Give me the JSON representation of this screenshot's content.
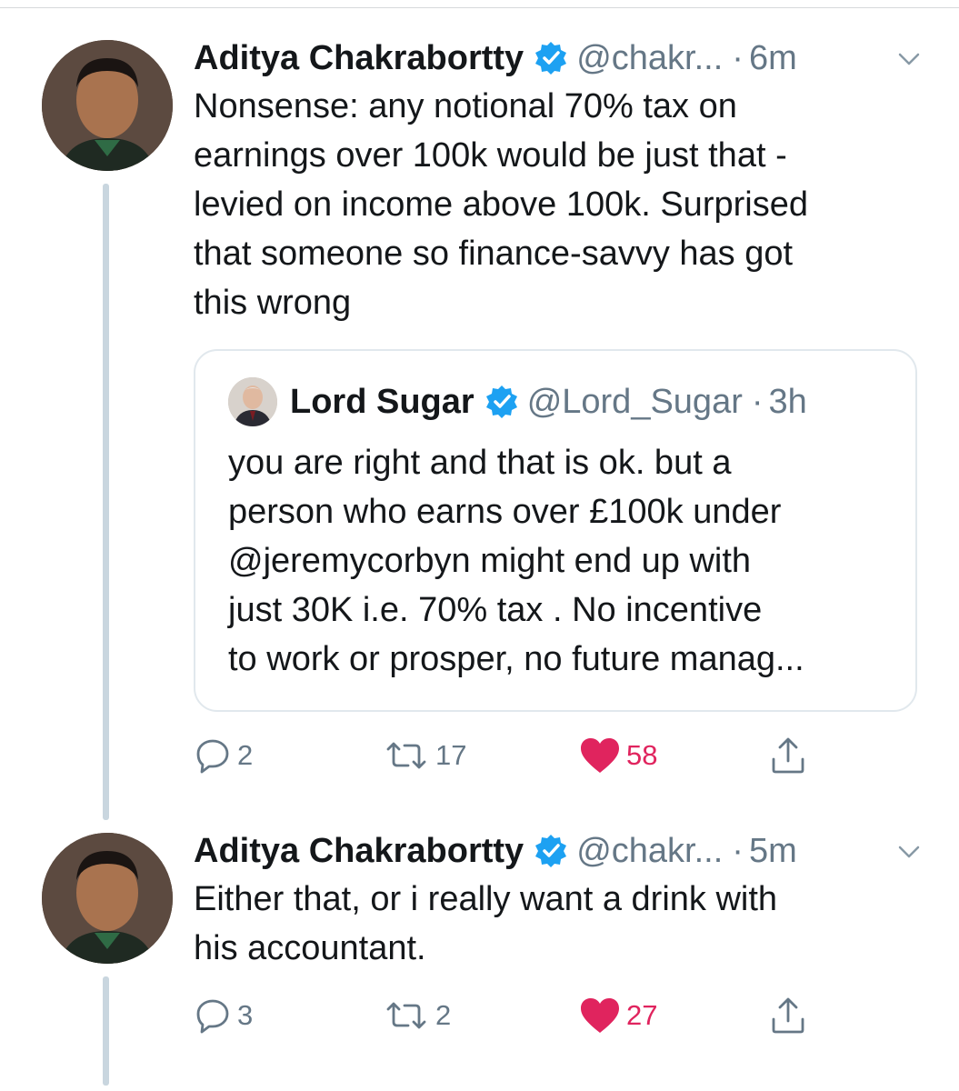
{
  "colors": {
    "verified_blue": "#1da1f2",
    "like_red": "#e0245e",
    "secondary_text": "#657786",
    "thread_line": "#c9d6df"
  },
  "tweets": [
    {
      "author_name": "Aditya Chakrabortty",
      "handle": "@chakr...",
      "dot": "·",
      "time": "6m",
      "text_lines": [
        "Nonsense: any notional 70% tax on",
        "earnings over 100k would be just that -",
        "levied on income above 100k. Surprised",
        "that someone so finance-savvy has got",
        "this wrong"
      ],
      "quote": {
        "author_name": "Lord Sugar",
        "handle": "@Lord_Sugar",
        "dot": "·",
        "time": "3h",
        "text_lines": [
          "you are right and that is ok. but a",
          "person who earns over £100k under",
          "@jeremycorbyn  might end up with",
          "just 30K  i.e. 70% tax . No incentive",
          "to work or prosper, no future manag..."
        ]
      },
      "replies": "2",
      "retweets": "17",
      "likes": "58"
    },
    {
      "author_name": "Aditya Chakrabortty",
      "handle": "@chakr...",
      "dot": "·",
      "time": "5m",
      "text_lines": [
        "Either that, or i really want a drink with",
        "his accountant."
      ],
      "replies": "3",
      "retweets": "2",
      "likes": "27"
    }
  ]
}
